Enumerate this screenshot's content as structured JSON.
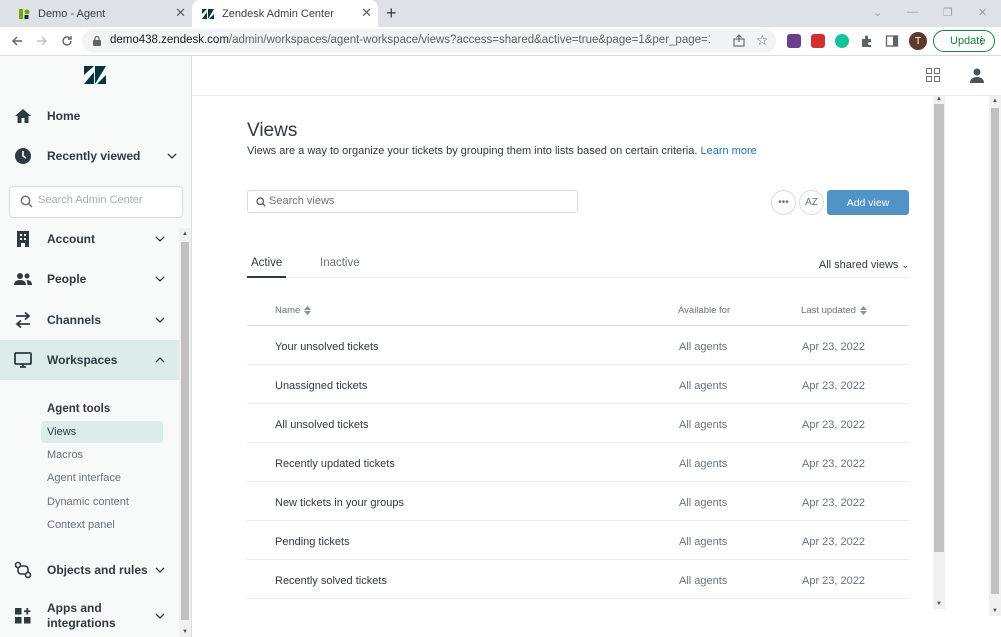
{
  "browser": {
    "tabs": [
      {
        "title": "Demo - Agent"
      },
      {
        "title": "Zendesk Admin Center"
      }
    ],
    "url_host": "demo438.zendesk.com",
    "url_path": "/admin/workspaces/agent-workspace/views?access=shared&active=true&page=1&per_page=100&so...",
    "profile_initial": "T",
    "update_label": "Update"
  },
  "sidebar": {
    "items": [
      {
        "label": "Home"
      },
      {
        "label": "Recently viewed"
      },
      {
        "label": "Account"
      },
      {
        "label": "People"
      },
      {
        "label": "Channels"
      },
      {
        "label": "Workspaces"
      },
      {
        "label": "Objects and rules"
      },
      {
        "label": "Apps and integrations"
      }
    ],
    "search_placeholder": "Search Admin Center",
    "subheading": "Agent tools",
    "subitems": [
      {
        "label": "Views"
      },
      {
        "label": "Macros"
      },
      {
        "label": "Agent interface"
      },
      {
        "label": "Dynamic content"
      },
      {
        "label": "Context panel"
      }
    ]
  },
  "main": {
    "title": "Views",
    "description": "Views are a way to organize your tickets by grouping them into lists based on certain criteria.",
    "learn_more": "Learn more",
    "search_placeholder": "Search views",
    "more_icon_text": "•••",
    "az_label": "AZ",
    "add_view_label": "Add view",
    "tabs": [
      {
        "label": "Active"
      },
      {
        "label": "Inactive"
      }
    ],
    "filter_label": "All shared views",
    "columns": {
      "name": "Name",
      "available": "Available for",
      "updated": "Last updated"
    },
    "rows": [
      {
        "name": "Your unsolved tickets",
        "available": "All agents",
        "updated": "Apr 23, 2022"
      },
      {
        "name": "Unassigned tickets",
        "available": "All agents",
        "updated": "Apr 23, 2022"
      },
      {
        "name": "All unsolved tickets",
        "available": "All agents",
        "updated": "Apr 23, 2022"
      },
      {
        "name": "Recently updated tickets",
        "available": "All agents",
        "updated": "Apr 23, 2022"
      },
      {
        "name": "New tickets in your groups",
        "available": "All agents",
        "updated": "Apr 23, 2022"
      },
      {
        "name": "Pending tickets",
        "available": "All agents",
        "updated": "Apr 23, 2022"
      },
      {
        "name": "Recently solved tickets",
        "available": "All agents",
        "updated": "Apr 23, 2022"
      }
    ]
  },
  "colors": {
    "primary_button": "#5293c7",
    "active_nav": "#dcece9",
    "link": "#1f73b7"
  }
}
